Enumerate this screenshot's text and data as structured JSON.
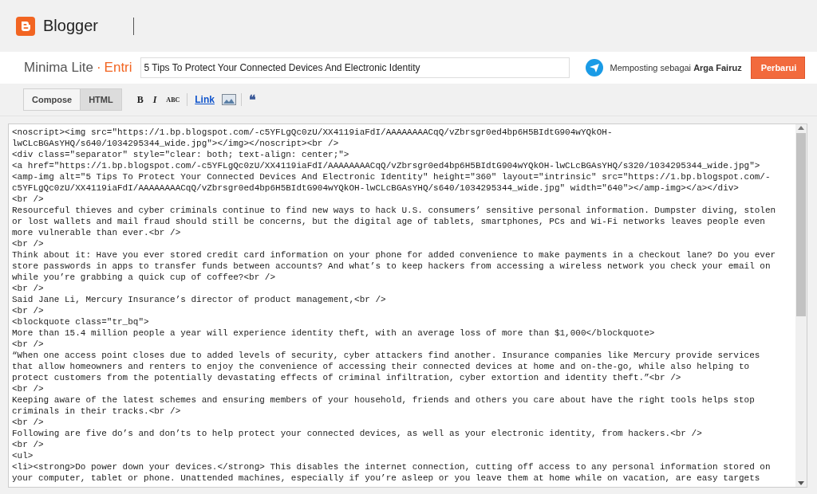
{
  "header": {
    "app_name": "Blogger"
  },
  "post_bar": {
    "blog_name": "Minima Lite",
    "separator": "·",
    "section": "Entri",
    "title_field": {
      "value": "5 Tips To Protect Your Connected Devices And Electronic Identity"
    },
    "posting_as": "Memposting sebagai **Arga Fairuz**",
    "update_button": "Perbarui"
  },
  "toolbar": {
    "modes": [
      {
        "label": "Compose",
        "selected": false
      },
      {
        "label": "HTML",
        "selected": true
      }
    ],
    "tools": [
      {
        "kind": "bold",
        "label": "B"
      },
      {
        "kind": "italic",
        "label": "I"
      },
      {
        "kind": "spell",
        "label": "ABC"
      },
      {
        "kind": "link",
        "label": "Link"
      },
      {
        "kind": "image"
      },
      {
        "kind": "quote",
        "label": "❝"
      }
    ]
  },
  "editor": {
    "lines": [
      "<noscript><img src=\"https://1.bp.blogspot.com/-c5YFLgQc0zU/XX4119iaFdI/AAAAAAAACqQ/vZbrsgr0ed4bp6H5BIdtG904wYQkOH-",
      "lwCLcBGAsYHQ/s640/1034295344_wide.jpg\"></img></noscript><br />",
      "<div class=\"separator\" style=\"clear: both; text-align: center;\">",
      "<a href=\"https://1.bp.blogspot.com/-c5YFLgQc0zU/XX4119iaFdI/AAAAAAAACqQ/vZbrsgr0ed4bp6H5BIdtG904wYQkOH-lwCLcBGAsYHQ/s320/1034295344_wide.jpg\">",
      "<amp-img alt=\"5 Tips To Protect Your Connected Devices And Electronic Identity\" height=\"360\" layout=\"intrinsic\" src=\"https://1.bp.blogspot.com/-",
      "c5YFLgQc0zU/XX4119iaFdI/AAAAAAAACqQ/vZbrsgr0ed4bp6H5BIdtG904wYQkOH-lwCLcBGAsYHQ/s640/1034295344_wide.jpg\" width=\"640\"></amp-img></a></div>",
      "<br />",
      "Resourceful thieves and cyber criminals continue to find new ways to hack U.S. consumers’ sensitive personal information. Dumpster diving, stolen",
      "or lost wallets and mail fraud should still be concerns, but the digital age of tablets, smartphones, PCs and Wi-Fi networks leaves people even",
      "more vulnerable than ever.<br />",
      "<br />",
      "Think about it: Have you ever stored credit card information on your phone for added convenience to make payments in a checkout lane? Do you ever",
      "store passwords in apps to transfer funds between accounts? And what’s to keep hackers from accessing a wireless network you check your email on",
      "while you’re grabbing a quick cup of coffee?<br />",
      "<br />",
      "Said Jane Li, Mercury Insurance’s director of product management,<br />",
      "<br />",
      "<blockquote class=\"tr_bq\">",
      "More than 15.4 million people a year will experience identity theft, with an average loss of more than $1,000</blockquote>",
      "<br />",
      "“When one access point closes due to added levels of security, cyber attackers find another. Insurance companies like Mercury provide services",
      "that allow homeowners and renters to enjoy the convenience of accessing their connected devices at home and on-the-go, while also helping to",
      "protect customers from the potentially devastating effects of criminal infiltration, cyber extortion and identity theft.”<br />",
      "<br />",
      "Keeping aware of the latest schemes and ensuring members of your household, friends and others you care about have the right tools helps stop",
      "criminals in their tracks.<br />",
      "<br />",
      "Following are five do’s and don’ts to help protect your connected devices, as well as your electronic identity, from hackers.<br />",
      "<br />",
      "<ul>",
      "<li><strong>Do power down your devices.</strong> This disables the internet connection, cutting off access to any personal information stored on",
      "your computer, tablet or phone. Unattended machines, especially if you’re asleep or you leave them at home while on vacation, are easy targets"
    ]
  }
}
